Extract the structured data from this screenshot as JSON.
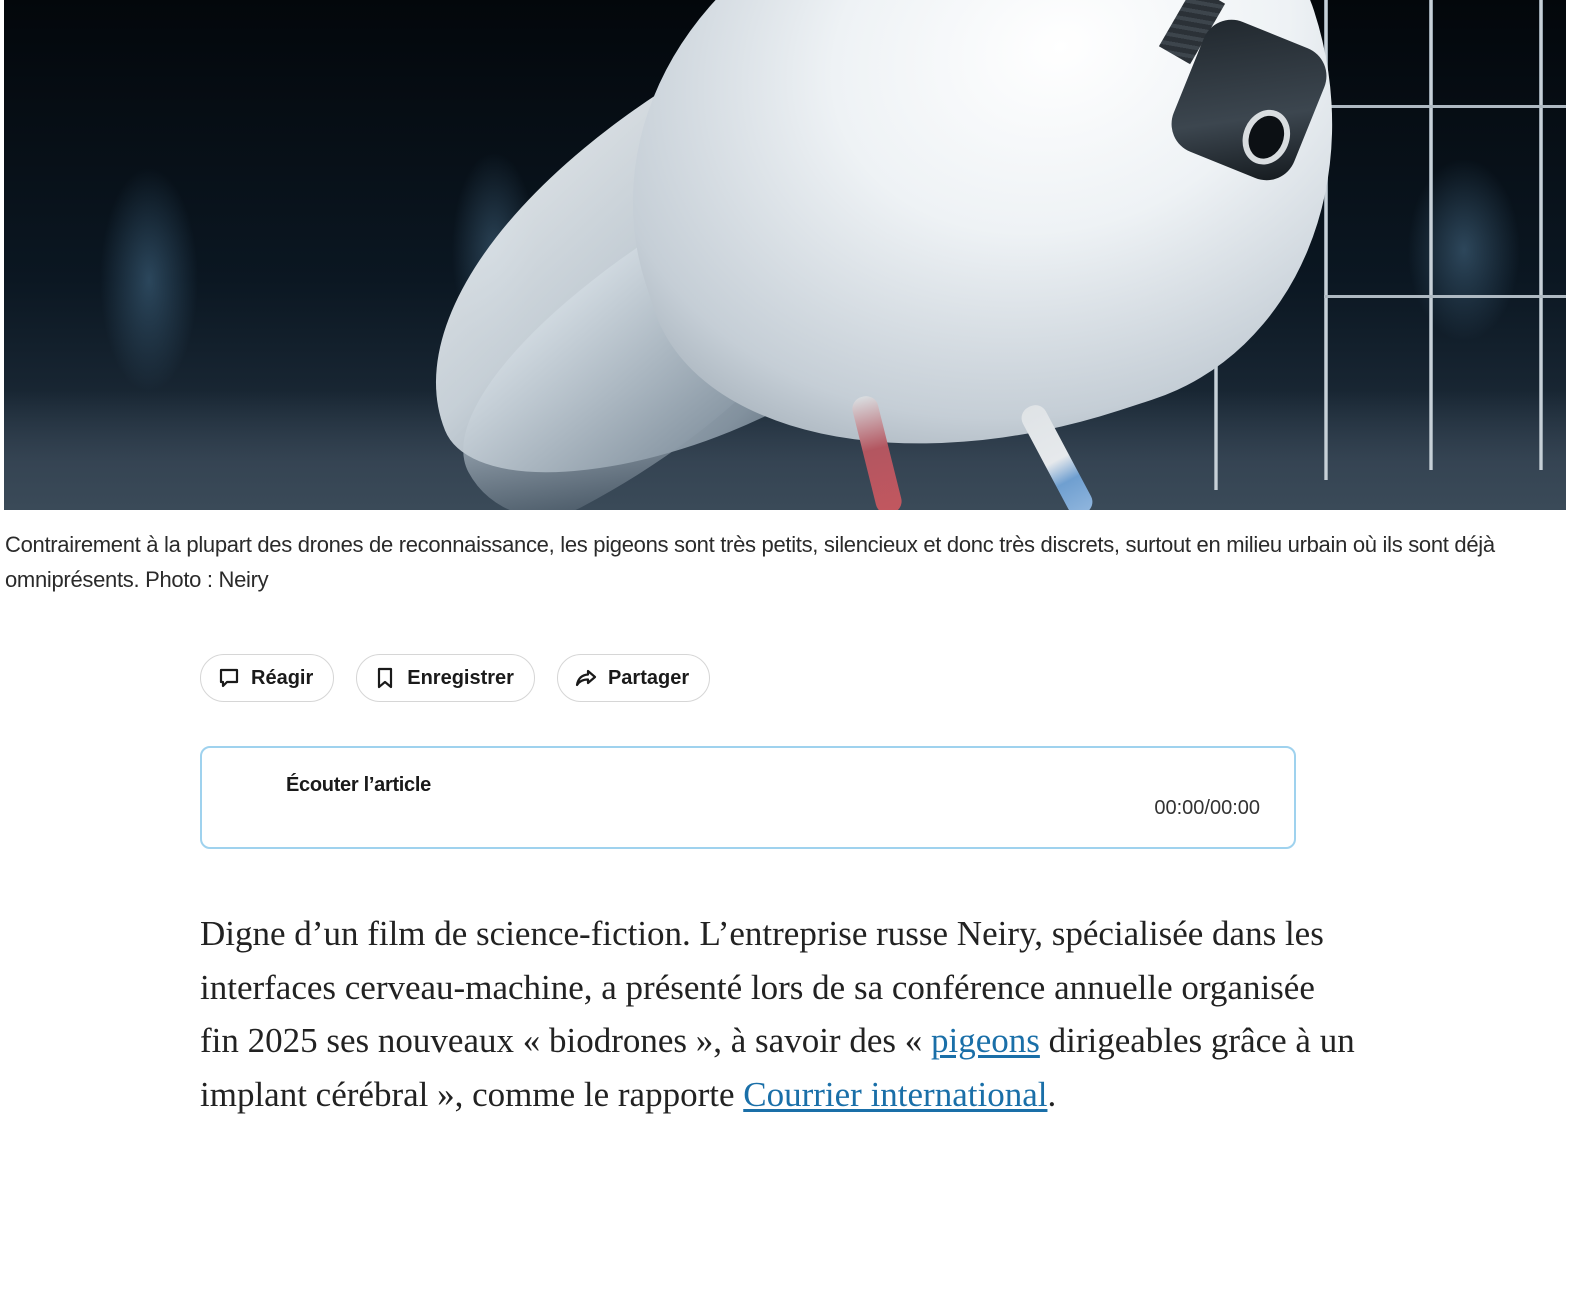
{
  "hero": {
    "alt": "Pigeon blanc équipé d'un implant dans une cage"
  },
  "caption": {
    "text": "Contrairement à la plupart des drones de reconnaissance, les pigeons sont très petits, silencieux et donc très discrets, surtout en milieu urbain où ils sont déjà omniprésents. Photo : Neiry"
  },
  "actions": {
    "react_label": "Réagir",
    "save_label": "Enregistrer",
    "share_label": "Partager",
    "icons": [
      "comment-icon",
      "bookmark-icon",
      "share-icon"
    ]
  },
  "audio": {
    "title": "Écouter l’article",
    "time": "00:00/00:00",
    "border_color": "#9fd2ee"
  },
  "article": {
    "part1": "Digne d’un film de science-fiction. L’entreprise russe Neiry, spécialisée dans les interfaces cerveau-machine, a présenté lors de sa conférence annuelle organisée fin 2025 ses nouveaux « biodrones », à savoir des « ",
    "link1": "pigeons",
    "part2": " dirigeables grâce à un implant cérébral », comme le rapporte ",
    "link2": "Courrier international",
    "part3": ".",
    "link_color": "#1a6fa8"
  }
}
